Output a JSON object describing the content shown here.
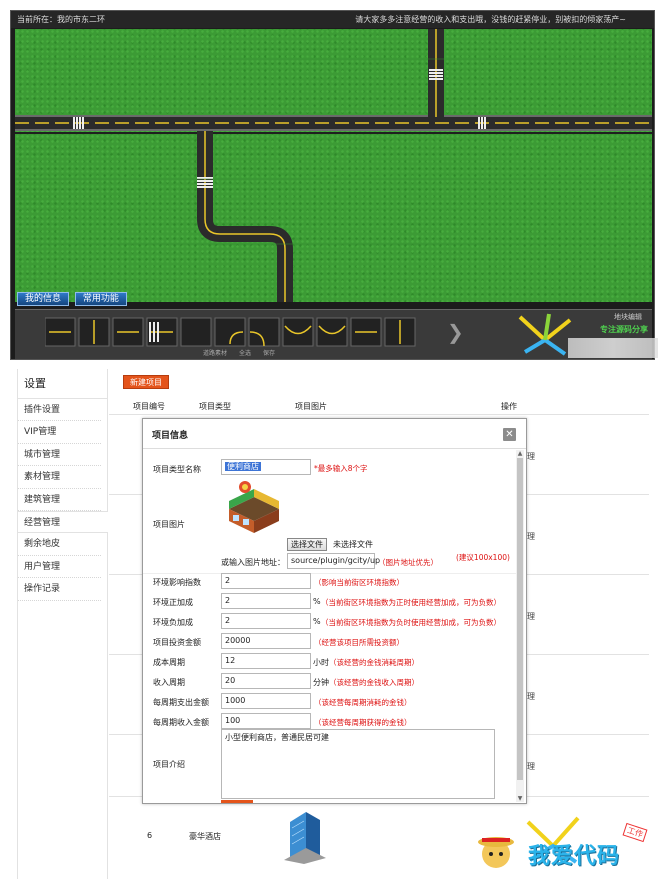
{
  "game": {
    "location": "当前所在：我的市东二环",
    "notice": "请大家多多注意经营的收入和支出哦，没钱的赶紧停业，别被扣的倾家荡产~",
    "tabs": [
      "我的信息",
      "常用功能"
    ],
    "palette_labels": [
      "道路素材",
      "全选",
      "保存"
    ],
    "edit_link": "地块编辑",
    "logo_tag": "专注源码分享"
  },
  "sidebar": {
    "title": "设置",
    "items": [
      {
        "label": "插件设置"
      },
      {
        "label": "VIP管理"
      },
      {
        "label": "城市管理"
      },
      {
        "label": "素材管理"
      },
      {
        "label": "建筑管理"
      },
      {
        "label": "经营管理"
      },
      {
        "label": "剩余地皮"
      },
      {
        "label": "用户管理"
      },
      {
        "label": "操作记录"
      }
    ],
    "active_index": 5
  },
  "content": {
    "new_button": "新建项目",
    "columns": [
      "项目编号",
      "项目类型",
      "项目图片",
      "操作"
    ],
    "row_op": "理",
    "last_row": {
      "num": "6",
      "type": "豪华酒店"
    }
  },
  "modal": {
    "title": "项目信息",
    "close": "✕",
    "name_label": "项目类型名称",
    "name_value": "便利商店",
    "name_hint": "*最多输入8个字",
    "image_label": "项目图片",
    "file_button": "选择文件",
    "file_none": "未选择文件",
    "url_label": "或输入图片地址：",
    "url_value": "source/plugin/gcity/up",
    "url_hint": "（图片地址优先）",
    "size_hint": "(建议100x100)",
    "fields": [
      {
        "label": "环境影响指数",
        "value": "2",
        "unit": "",
        "hint": "（影响当前街区环境指数）"
      },
      {
        "label": "环境正加成",
        "value": "2",
        "unit": "%",
        "hint": "（当前街区环境指数为正时使用经营加成，可为负数）"
      },
      {
        "label": "环境负加成",
        "value": "2",
        "unit": "%",
        "hint": "（当前街区环境指数为负时使用经营加成，可为负数）"
      },
      {
        "label": "项目投资金额",
        "value": "20000",
        "unit": "",
        "hint": "（经营该项目所需投资额）"
      },
      {
        "label": "成本周期",
        "value": "12",
        "unit": "小时",
        "hint": "（该经营的金钱消耗周期）"
      },
      {
        "label": "收入周期",
        "value": "20",
        "unit": "分钟",
        "hint": "（该经营的金钱收入周期）"
      },
      {
        "label": "每周期支出金额",
        "value": "1000",
        "unit": "",
        "hint": "（该经营每周期消耗的金钱）"
      },
      {
        "label": "每周期收入金额",
        "value": "100",
        "unit": "",
        "hint": "（该经营每周期获得的金钱）"
      }
    ],
    "intro_label": "项目介绍",
    "intro_value": "小型便利商店，普通民居可建"
  },
  "watermark": {
    "text": "我爱代码",
    "badge": "工作"
  }
}
